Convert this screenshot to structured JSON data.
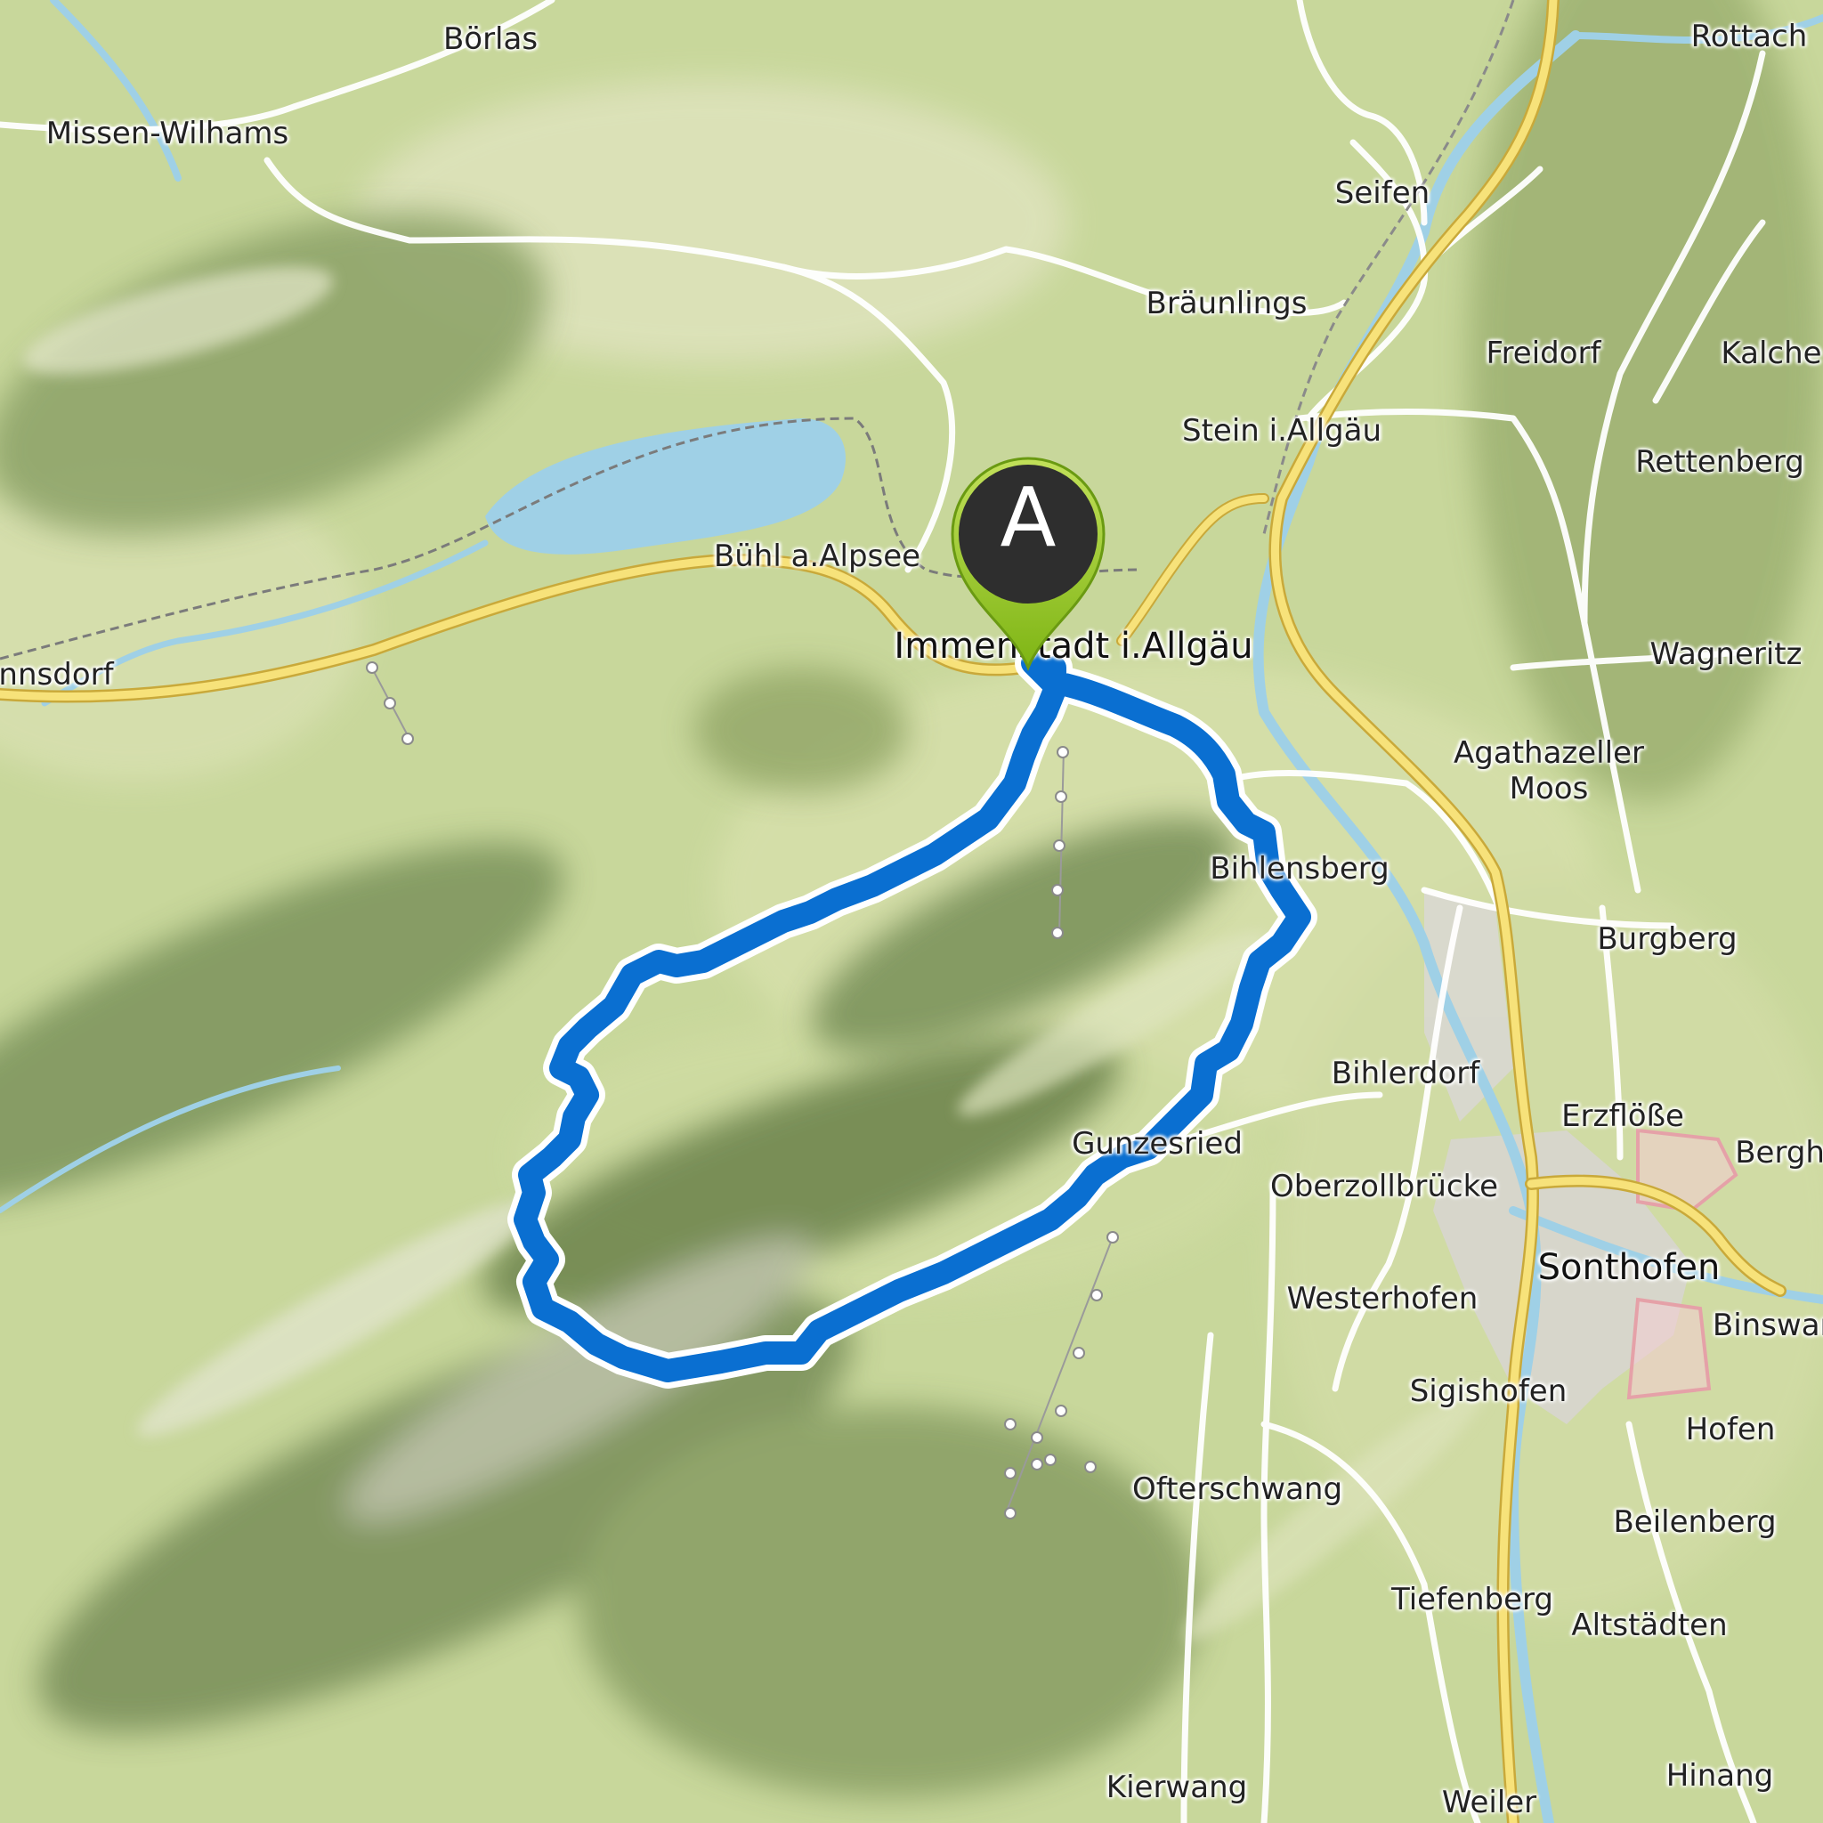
{
  "map": {
    "start_marker_label": "A",
    "colors": {
      "route": "#0a6fd1",
      "route_outline": "#ffffff",
      "water": "#9fd0e6",
      "road_major": "#f7e27a",
      "road_major_edge": "#c9a93a",
      "marker": "#8fc31f",
      "marker_inner": "#2e2e2e",
      "restricted_area": "#e5a1a8"
    },
    "places": [
      {
        "id": "boerlas",
        "name": "Börlas"
      },
      {
        "id": "missen-wilhams",
        "name": "Missen-Wilhams"
      },
      {
        "id": "seifen",
        "name": "Seifen"
      },
      {
        "id": "rottach",
        "name": "Rottach"
      },
      {
        "id": "braeunlings",
        "name": "Bräunlings"
      },
      {
        "id": "freidorf",
        "name": "Freidorf"
      },
      {
        "id": "kalche",
        "name": "Kalche"
      },
      {
        "id": "stein",
        "name": "Stein i.Allgäu"
      },
      {
        "id": "rettenberg",
        "name": "Rettenberg"
      },
      {
        "id": "buehl",
        "name": "Bühl a.Alpsee"
      },
      {
        "id": "immenstadt",
        "name": "Immenstadt i.Allgäu"
      },
      {
        "id": "wagneritz",
        "name": "Wagneritz"
      },
      {
        "id": "nnsdorf",
        "name": "nnsdorf"
      },
      {
        "id": "agathazeller",
        "name": "Agathazeller"
      },
      {
        "id": "moos",
        "name": "Moos"
      },
      {
        "id": "bihlensberg",
        "name": "Bihlensberg"
      },
      {
        "id": "burgberg",
        "name": "Burgberg"
      },
      {
        "id": "bihlerdorf",
        "name": "Bihlerdorf"
      },
      {
        "id": "erzfloesse",
        "name": "Erzflöße"
      },
      {
        "id": "berghofen",
        "name": "Bergho"
      },
      {
        "id": "gunzesried",
        "name": "Gunzesried"
      },
      {
        "id": "oberzollbruecke",
        "name": "Oberzollbrücke"
      },
      {
        "id": "sonthofen",
        "name": "Sonthofen"
      },
      {
        "id": "westerhofen",
        "name": "Westerhofen"
      },
      {
        "id": "binswang",
        "name": "Binswan"
      },
      {
        "id": "sigishofen",
        "name": "Sigishofen"
      },
      {
        "id": "hofen",
        "name": "Hofen"
      },
      {
        "id": "ofterschwang",
        "name": "Ofterschwang"
      },
      {
        "id": "beilenberg",
        "name": "Beilenberg"
      },
      {
        "id": "tiefenberg",
        "name": "Tiefenberg"
      },
      {
        "id": "altstaedten",
        "name": "Altstädten"
      },
      {
        "id": "kierwang",
        "name": "Kierwang"
      },
      {
        "id": "weiler",
        "name": "Weiler"
      },
      {
        "id": "hinang",
        "name": "Hinang"
      }
    ]
  }
}
